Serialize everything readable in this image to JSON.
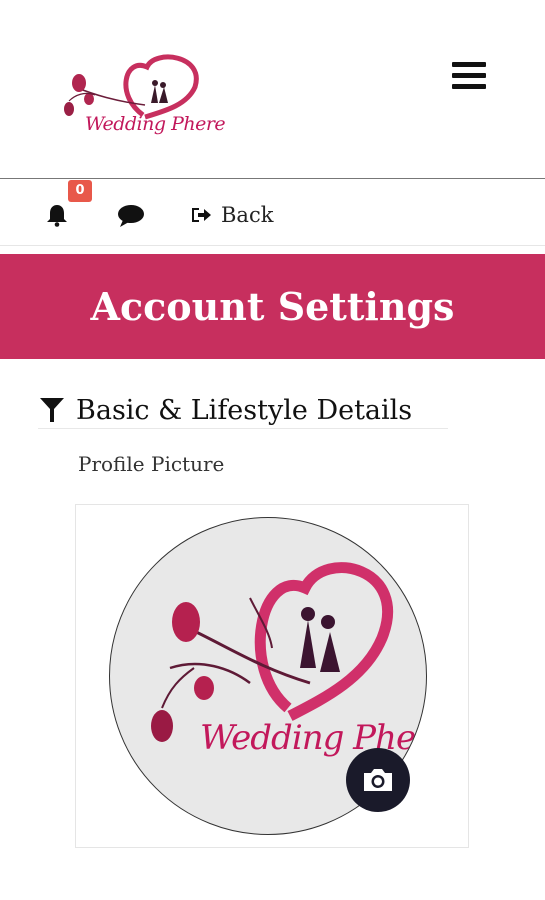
{
  "header": {
    "logo_text": "Wedding Phere",
    "menu_icon": "hamburger-menu-icon"
  },
  "toolbar": {
    "notification_count": "0",
    "bell_icon": "bell-icon",
    "chat_icon": "chat-bubble-icon",
    "back_label": "Back",
    "back_icon": "sign-out-icon"
  },
  "banner": {
    "title": "Account Settings"
  },
  "section": {
    "title": "Basic & Lifestyle Details",
    "icon": "filter-icon"
  },
  "profile": {
    "label": "Profile Picture",
    "picture_logo_text": "Wedding Phere",
    "camera_icon": "camera-icon"
  },
  "colors": {
    "brand": "#c72f5e",
    "badge": "#e8584a",
    "camera_button": "#1a1a2a"
  }
}
